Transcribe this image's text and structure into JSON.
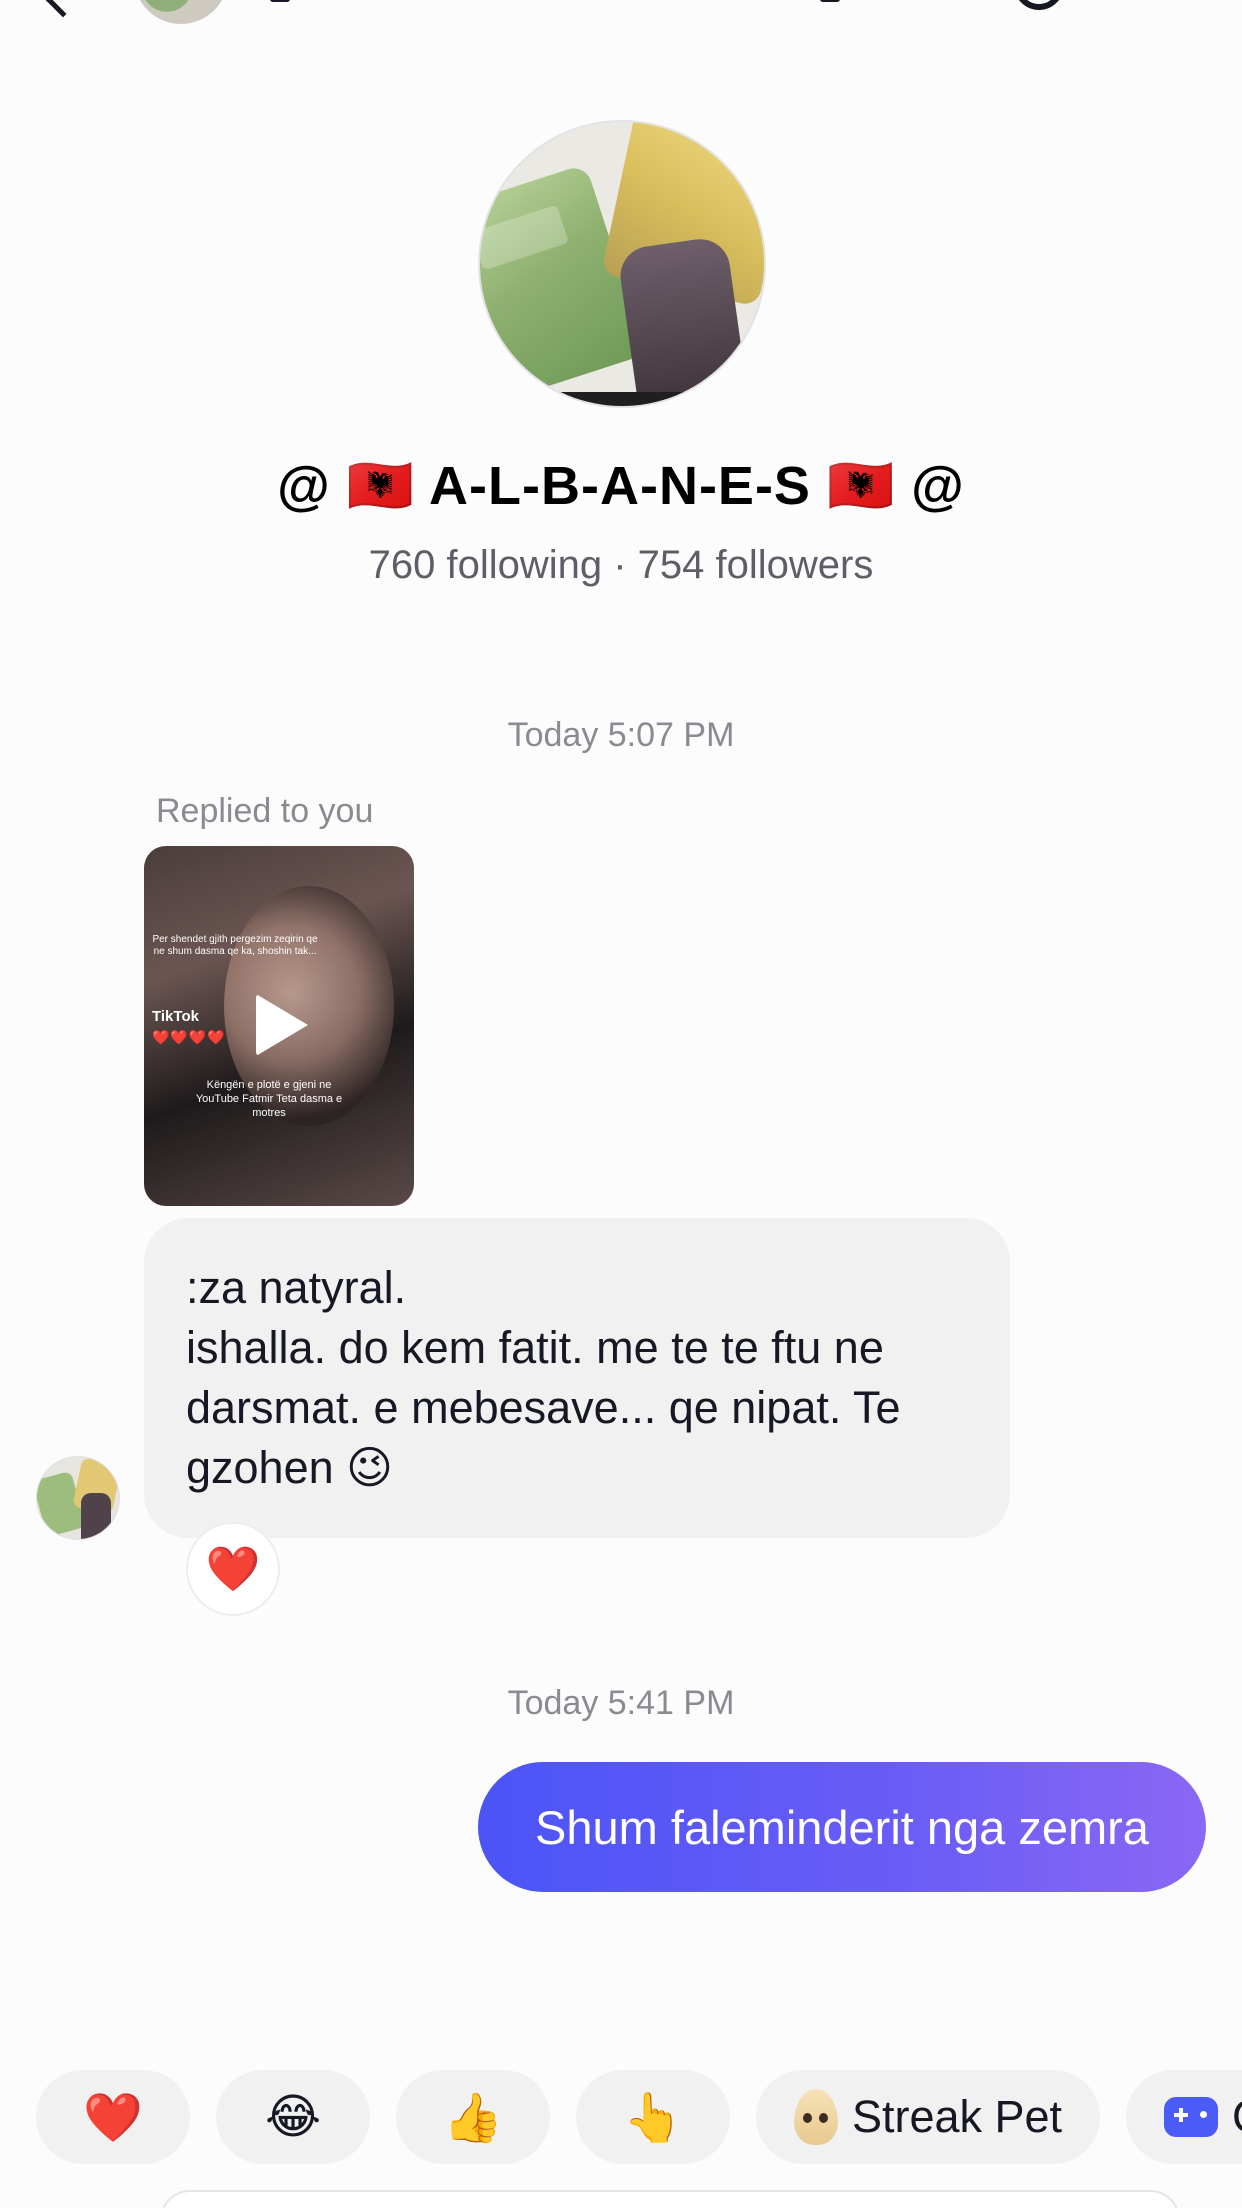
{
  "header": {
    "back_label": "",
    "title_partial": ""
  },
  "profile": {
    "name": "@ 🇦🇱 A-L-B-A-N-E-S 🇦🇱 @",
    "following_count": "760",
    "following_label": "following",
    "followers_count": "754",
    "followers_label": "followers",
    "stats_text": "760 following · 754 followers"
  },
  "conversation": {
    "timestamp_1": "Today 5:07 PM",
    "replied_label": "Replied to you",
    "video": {
      "top_text": "Per shendet gjith pergezim zeqirin qe ne shum dasma qe ka, shoshin tak...",
      "brand": "TikTok",
      "hearts": "❤️❤️❤️❤️",
      "bottom_text": "Këngën e plotë e gjeni ne YouTube Fatmir Teta dasma e motres"
    },
    "incoming_message": ":za natyral.\nishalla. do kem fatit. me te te ftu ne darsmat. e mebesave... qe nipat. Te gzohen 😉",
    "incoming_reaction": "❤️",
    "timestamp_2": "Today 5:41 PM",
    "outgoing_message": "Shum faleminderit nga zemra"
  },
  "quick_reactions": [
    {
      "emoji": "❤️"
    },
    {
      "emoji": "😂"
    },
    {
      "emoji": "👍"
    },
    {
      "emoji": "👆"
    },
    {
      "label": "Streak Pet",
      "icon": "egg-pet-icon"
    },
    {
      "label": "G",
      "icon": "game-controller-icon"
    }
  ],
  "colors": {
    "outgoing_start": "#4b54f6",
    "outgoing_end": "#8b67f4",
    "incoming_bg": "#f1f1f2",
    "accent_red": "#fe2c55"
  }
}
